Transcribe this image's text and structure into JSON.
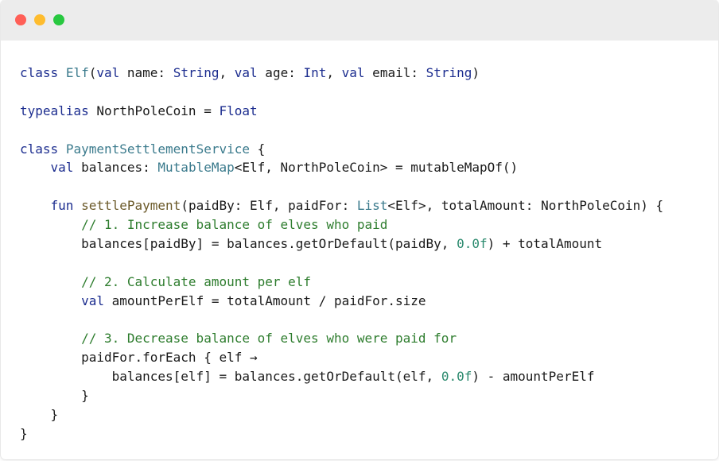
{
  "window": {
    "controls": {
      "close": "close-dot",
      "minimize": "minimize-dot",
      "maximize": "maximize-dot"
    },
    "colors": {
      "close": "#ff5f57",
      "minimize": "#febc2e",
      "maximize": "#28c840",
      "titlebar": "#ececec",
      "keyword": "#1c2d8f",
      "class_name": "#3a7a8c",
      "function_name": "#6b5a2a",
      "comment": "#2e7d2e",
      "number": "#2b8a6e"
    }
  },
  "code": {
    "l1": {
      "kw1": "class",
      "s1": " ",
      "cls1": "Elf",
      "s2": "(",
      "kw2": "val",
      "s3": " name: ",
      "ty1": "String",
      "s4": ", ",
      "kw3": "val",
      "s5": " age: ",
      "ty2": "Int",
      "s6": ", ",
      "kw4": "val",
      "s7": " email: ",
      "ty3": "String",
      "s8": ")"
    },
    "l3": {
      "kw1": "typealias",
      "s1": " NorthPoleCoin = ",
      "ty1": "Float"
    },
    "l5": {
      "kw1": "class",
      "s1": " ",
      "cls1": "PaymentSettlementService",
      "s2": " {"
    },
    "l6": {
      "indent": "    ",
      "kw1": "val",
      "s1": " balances: ",
      "cls1": "MutableMap",
      "s2": "<Elf, NorthPoleCoin> = mutableMapOf()"
    },
    "l8": {
      "indent": "    ",
      "kw1": "fun",
      "s1": " ",
      "fn1": "settlePayment",
      "s2": "(paidBy: Elf, paidFor: ",
      "cls1": "List",
      "s3": "<Elf>, totalAmount: NorthPoleCoin) {"
    },
    "l9": {
      "indent": "        ",
      "cm": "// 1. Increase balance of elves who paid"
    },
    "l10": {
      "indent": "        ",
      "s1": "balances[paidBy] = balances.getOrDefault(paidBy, ",
      "num1": "0.0f",
      "s2": ") + totalAmount"
    },
    "l12": {
      "indent": "        ",
      "cm": "// 2. Calculate amount per elf"
    },
    "l13": {
      "indent": "        ",
      "kw1": "val",
      "s1": " amountPerElf = totalAmount / paidFor.size"
    },
    "l15": {
      "indent": "        ",
      "cm": "// 3. Decrease balance of elves who were paid for"
    },
    "l16": {
      "indent": "        ",
      "s1": "paidFor.forEach { elf →"
    },
    "l17": {
      "indent": "            ",
      "s1": "balances[elf] = balances.getOrDefault(elf, ",
      "num1": "0.0f",
      "s2": ") - amountPerElf"
    },
    "l18": {
      "indent": "        ",
      "s1": "}"
    },
    "l19": {
      "indent": "    ",
      "s1": "}"
    },
    "l20": {
      "s1": "}"
    }
  }
}
